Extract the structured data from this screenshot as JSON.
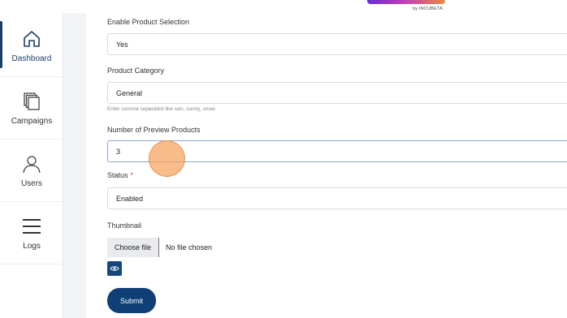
{
  "brand": {
    "by_text": "by INCUBETA"
  },
  "sidebar": {
    "items": [
      {
        "label": "Dashboard",
        "icon": "home-icon",
        "active": true
      },
      {
        "label": "Campaigns",
        "icon": "stack-icon",
        "active": false
      },
      {
        "label": "Users",
        "icon": "user-icon",
        "active": false
      },
      {
        "label": "Logs",
        "icon": "menu-icon",
        "active": false
      }
    ]
  },
  "form": {
    "enable_selection": {
      "label": "Enable Product Selection",
      "value": "Yes"
    },
    "category": {
      "label": "Product Category",
      "value": "General",
      "helper": "Enter comma separated like rain, sunny, snow"
    },
    "preview_count": {
      "label": "Number of Preview Products",
      "value": "3"
    },
    "status": {
      "label": "Status",
      "required_mark": "*",
      "value": "Enabled"
    },
    "thumbnail": {
      "label": "Thumbnail",
      "choose_label": "Choose file",
      "file_status": "No file chosen",
      "preview_icon": "eye-icon"
    },
    "submit_label": "Submit"
  },
  "colors": {
    "primary": "#0f3f75",
    "required": "#e03b24",
    "cursor_highlight": "#f5a05a"
  }
}
